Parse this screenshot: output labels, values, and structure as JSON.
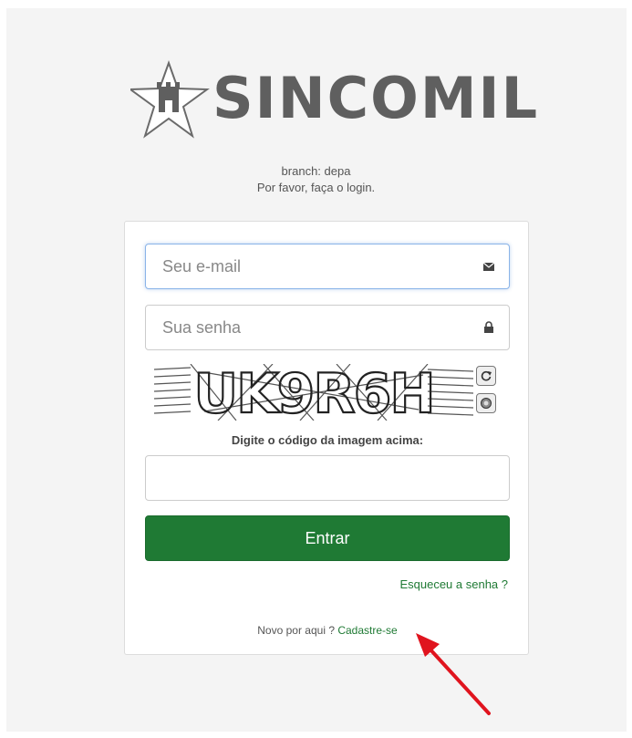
{
  "brand": {
    "logo_text": "SINCOMIL"
  },
  "header": {
    "branch": "branch: depa",
    "message": "Por favor, faça o login."
  },
  "form": {
    "email_placeholder": "Seu e-mail",
    "email_value": "",
    "password_placeholder": "Sua senha",
    "password_value": "",
    "captcha_text": "UK9R6H",
    "captcha_label": "Digite o código da imagem acima:",
    "captcha_value": "",
    "submit_label": "Entrar",
    "forgot_label": "Esqueceu a senha ?",
    "new_here": "Novo por aqui ?",
    "signup_label": "Cadastre-se",
    "icons": {
      "email": "envelope-icon",
      "password": "lock-icon",
      "captcha_refresh": "refresh-icon",
      "captcha_audio": "audio-icon"
    }
  },
  "colors": {
    "accent": "#1f7a34",
    "logo": "#5f5f5f",
    "annotation_arrow": "#e0141e"
  }
}
